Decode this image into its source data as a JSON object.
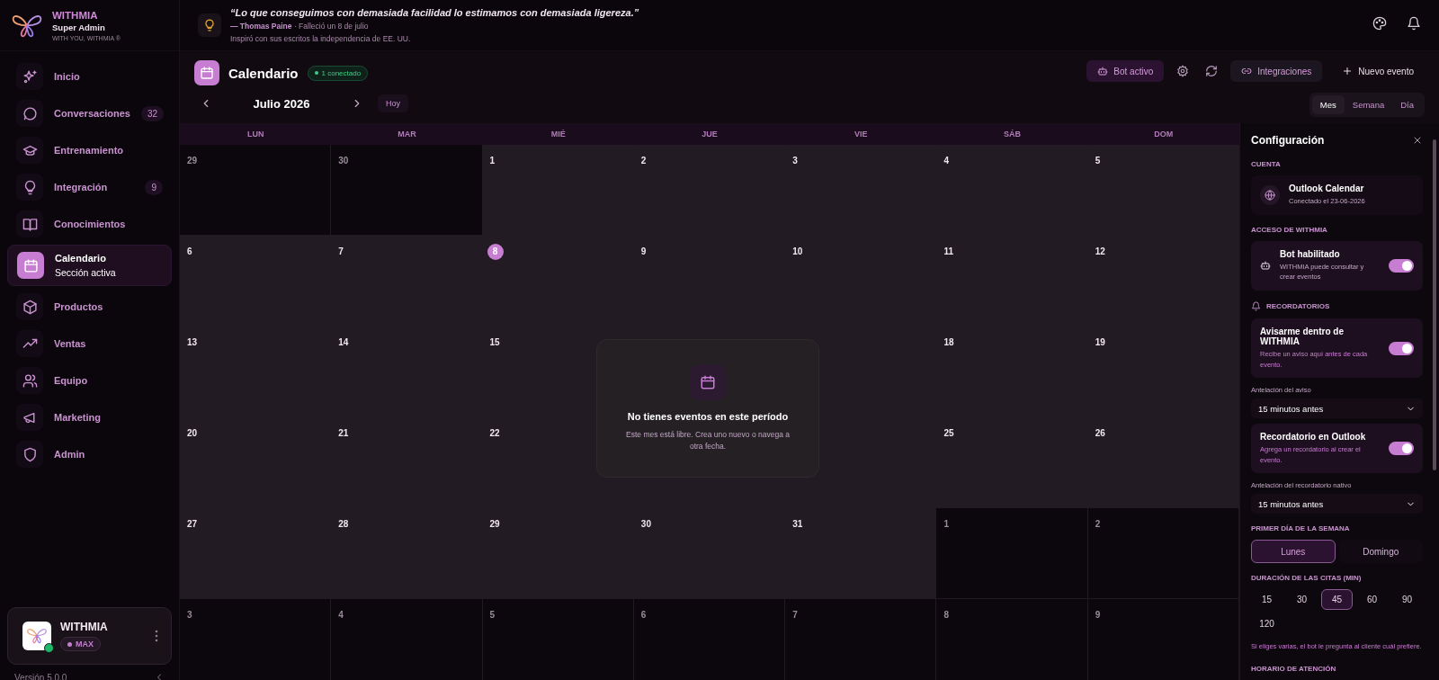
{
  "brand": {
    "name": "WITHMIA",
    "role": "Super Admin",
    "tagline": "WITH YOU, WITHMIA ®"
  },
  "quote": {
    "text": "“Lo que conseguimos con demasiada facilidad lo estimamos con demasiada ligereza.”",
    "author": "— Thomas Paine",
    "note": "· Falleció un 8 de julio",
    "detail": "Inspiró con sus escritos la independencia de EE. UU."
  },
  "sidebar": {
    "items": [
      {
        "label": "Inicio",
        "selected": false
      },
      {
        "label": "Conversaciones",
        "badge": "32",
        "selected": false
      },
      {
        "label": "Entrenamiento",
        "selected": false
      },
      {
        "label": "Integración",
        "badge": "9",
        "selected": false
      },
      {
        "label": "Conocimientos",
        "selected": false
      },
      {
        "label": "Calendario",
        "subtitle": "Sección activa",
        "selected": true
      },
      {
        "label": "Productos",
        "selected": false
      },
      {
        "label": "Ventas",
        "selected": false
      },
      {
        "label": "Equipo",
        "selected": false
      },
      {
        "label": "Marketing",
        "selected": false
      },
      {
        "label": "Admin",
        "selected": false
      }
    ],
    "account": {
      "name": "WITHMIA",
      "plan": "MAX",
      "online": true
    },
    "version": "Versión 5.0.0"
  },
  "calendar": {
    "title": "Calendario",
    "status": "1 conectado",
    "month": "Julio 2026",
    "today_button": "Hoy",
    "actions": [
      {
        "label": "Bot activo",
        "kind": "accent"
      },
      {
        "label": "Integraciones",
        "kind": "muted"
      },
      {
        "label": "Nuevo evento",
        "kind": "ghost"
      }
    ],
    "views": [
      {
        "label": "Mes",
        "selected": true
      },
      {
        "label": "Semana",
        "selected": false
      },
      {
        "label": "Día",
        "selected": false
      }
    ],
    "weekdays": [
      "LUN",
      "MAR",
      "MIÉ",
      "JUE",
      "VIE",
      "SÁB",
      "DOM"
    ],
    "weeks": [
      [
        {
          "label": "29",
          "in_month": false,
          "today": false
        },
        {
          "label": "30",
          "in_month": false,
          "today": false
        },
        {
          "label": "1",
          "in_month": true,
          "today": false
        },
        {
          "label": "2",
          "in_month": true,
          "today": false
        },
        {
          "label": "3",
          "in_month": true,
          "today": false
        },
        {
          "label": "4",
          "in_month": true,
          "today": false
        },
        {
          "label": "5",
          "in_month": true,
          "today": false
        }
      ],
      [
        {
          "label": "6",
          "in_month": true,
          "today": false
        },
        {
          "label": "7",
          "in_month": true,
          "today": false
        },
        {
          "label": "8",
          "in_month": true,
          "today": true
        },
        {
          "label": "9",
          "in_month": true,
          "today": false
        },
        {
          "label": "10",
          "in_month": true,
          "today": false
        },
        {
          "label": "11",
          "in_month": true,
          "today": false
        },
        {
          "label": "12",
          "in_month": true,
          "today": false
        }
      ],
      [
        {
          "label": "13",
          "in_month": true,
          "today": false
        },
        {
          "label": "14",
          "in_month": true,
          "today": false
        },
        {
          "label": "15",
          "in_month": true,
          "today": false
        },
        {
          "in_month": true
        },
        {
          "in_month": true
        },
        {
          "label": "18",
          "in_month": true,
          "today": false
        },
        {
          "label": "19",
          "in_month": true,
          "today": false
        }
      ],
      [
        {
          "label": "20",
          "in_month": true,
          "today": false
        },
        {
          "label": "21",
          "in_month": true,
          "today": false
        },
        {
          "label": "22",
          "in_month": true,
          "today": false
        },
        {
          "in_month": true
        },
        {
          "in_month": true
        },
        {
          "label": "25",
          "in_month": true,
          "today": false
        },
        {
          "label": "26",
          "in_month": true,
          "today": false
        }
      ],
      [
        {
          "label": "27",
          "in_month": true,
          "today": false
        },
        {
          "label": "28",
          "in_month": true,
          "today": false
        },
        {
          "label": "29",
          "in_month": true,
          "today": false
        },
        {
          "label": "30",
          "in_month": true,
          "today": false
        },
        {
          "label": "31",
          "in_month": true,
          "today": false
        },
        {
          "label": "1",
          "in_month": false,
          "today": false
        },
        {
          "label": "2",
          "in_month": false,
          "today": false
        }
      ],
      [
        {
          "label": "3",
          "in_month": false,
          "today": false
        },
        {
          "label": "4",
          "in_month": false,
          "today": false
        },
        {
          "label": "5",
          "in_month": false,
          "today": false
        },
        {
          "label": "6",
          "in_month": false,
          "today": false
        },
        {
          "label": "7",
          "in_month": false,
          "today": false
        },
        {
          "label": "8",
          "in_month": false,
          "today": false
        },
        {
          "label": "9",
          "in_month": false,
          "today": false
        }
      ]
    ]
  },
  "empty_state": {
    "title": "No tienes eventos en este período",
    "message": "Este mes está libre. Crea uno nuevo o navega a otra fecha."
  },
  "settings_panel": {
    "title": "Configuración",
    "account_label": "CUENTA",
    "account": {
      "name": "Outlook Calendar",
      "detail": "Conectado el 23-06-2026"
    },
    "access_label": "ACCESO DE WITHMIA",
    "bot": {
      "title": "Bot habilitado",
      "description": "WITHMIA puede consultar y crear eventos",
      "on": true
    },
    "reminders_label": "RECORDATORIOS",
    "reminders": [
      {
        "title": "Avisarme dentro de WITHMIA",
        "description": "Recibe un aviso aquí antes de cada evento.",
        "on": true,
        "field_label": "Antelación del aviso",
        "value": "15 minutos antes"
      },
      {
        "title": "Recordatorio en Outlook",
        "description": "Agrega un recordatorio al crear el evento.",
        "on": true,
        "field_label": "Antelación del recordatorio nativo",
        "value": "15 minutos antes"
      }
    ],
    "first_day_label": "PRIMER DÍA DE LA SEMANA",
    "first_day_options": [
      {
        "label": "Lunes",
        "selected": true
      },
      {
        "label": "Domingo",
        "selected": false
      }
    ],
    "duration_label": "DURACIÓN DE LAS CITAS (MIN)",
    "durations": [
      {
        "label": "15",
        "selected": false
      },
      {
        "label": "30",
        "selected": false
      },
      {
        "label": "45",
        "selected": true
      },
      {
        "label": "60",
        "selected": false
      },
      {
        "label": "90",
        "selected": false
      },
      {
        "label": "120",
        "selected": false
      }
    ],
    "duration_hint": "Si eliges varias, el bot le pregunta al cliente cuál prefiere.",
    "hours_label": "HORARIO DE ATENCIÓN"
  }
}
